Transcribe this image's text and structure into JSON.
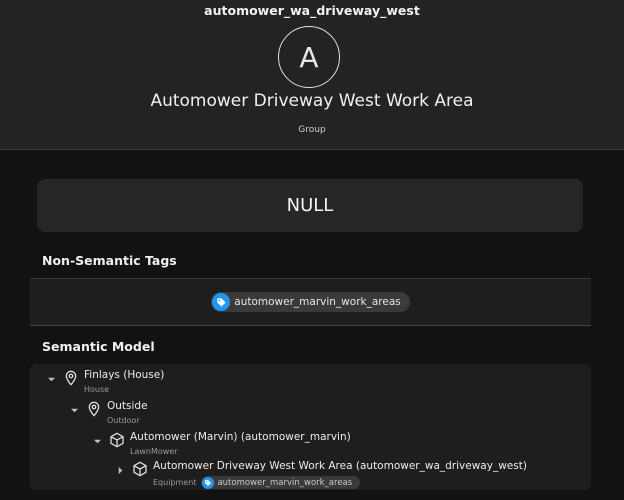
{
  "header": {
    "item_name": "automower_wa_driveway_west",
    "avatar_letter": "A",
    "label": "Automower Driveway West Work Area",
    "type": "Group"
  },
  "state": {
    "value": "NULL"
  },
  "non_semantic_tags": {
    "title": "Non-Semantic Tags",
    "tags": [
      "automower_marvin_work_areas"
    ]
  },
  "semantic_model": {
    "title": "Semantic Model",
    "nodes": [
      {
        "title": "Finlays (House)",
        "subtitle": "House",
        "icon": "location-pin-icon",
        "expanded": true
      },
      {
        "title": "Outside",
        "subtitle": "Outdoor",
        "icon": "location-pin-icon",
        "expanded": true
      },
      {
        "title": "Automower (Marvin) (automower_marvin)",
        "subtitle": "LawnMower",
        "icon": "cube-icon",
        "expanded": true
      },
      {
        "title": "Automower Driveway West Work Area (automower_wa_driveway_west)",
        "subtitle": "Equipment",
        "icon": "cube-icon",
        "expanded": false,
        "tag": "automower_marvin_work_areas"
      }
    ]
  },
  "colors": {
    "background": "#121212",
    "header_background": "#232323",
    "card_background": "#262626",
    "tag_accent": "#2196f3"
  }
}
